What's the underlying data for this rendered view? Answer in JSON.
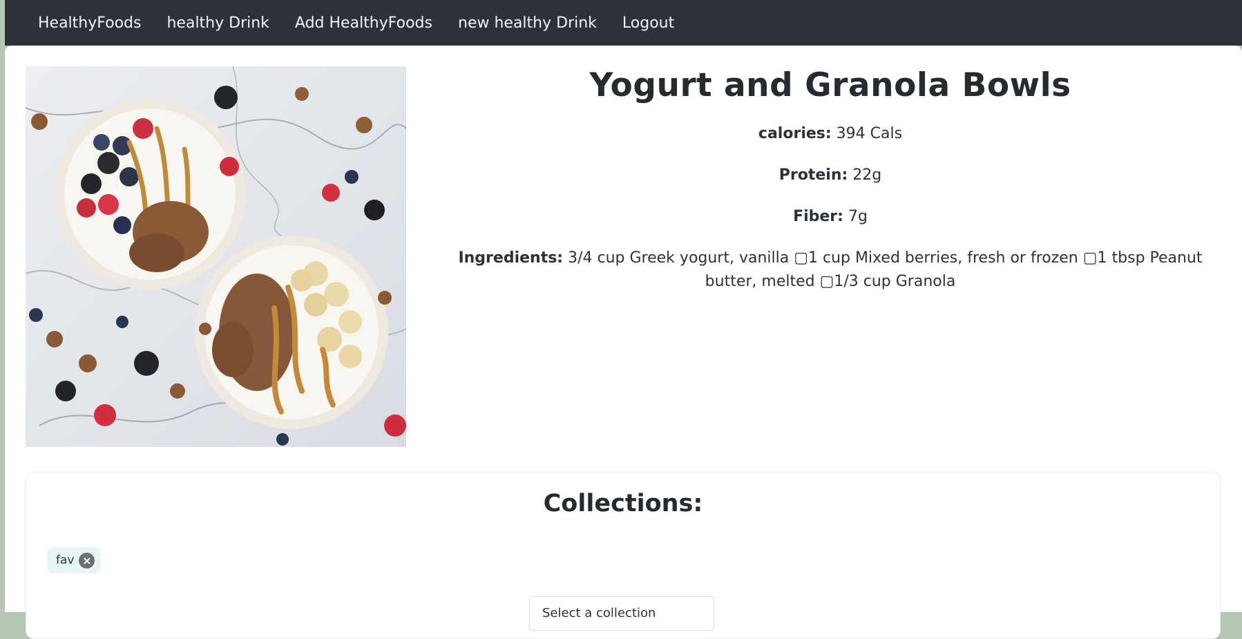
{
  "nav": {
    "items": [
      {
        "label": "HealthyFoods"
      },
      {
        "label": "healthy Drink"
      },
      {
        "label": "Add HealthyFoods"
      },
      {
        "label": "new healthy Drink"
      },
      {
        "label": "Logout"
      }
    ]
  },
  "recipe": {
    "title": "Yogurt and Granola Bowls",
    "calories_label": "calories:",
    "calories_value": "394 Cals",
    "protein_label": "Protein:",
    "protein_value": "22g",
    "fiber_label": "Fiber:",
    "fiber_value": "7g",
    "ingredients_label": "Ingredients:",
    "ingredients_value": "3/4 cup Greek yogurt, vanilla ▢1 cup Mixed berries, fresh or frozen ▢1 tbsp Peanut butter, melted ▢1/3 cup Granola"
  },
  "collections": {
    "title": "Collections:",
    "tags": [
      {
        "label": "fav",
        "remove_icon": "close-circle-icon"
      }
    ],
    "select_text": "Select a collection"
  },
  "colors": {
    "navbar": "#2d313a",
    "page_bg": "#b8c7b5",
    "tag_bg": "#e7f6f4"
  }
}
